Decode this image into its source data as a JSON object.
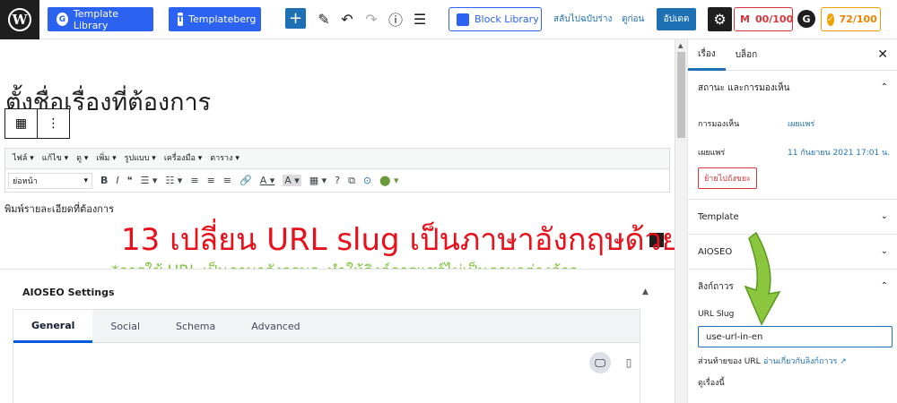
{
  "toolbar": {
    "wp_logo": "W",
    "template_library_label": "Template Library",
    "template_library_icon": "G",
    "templateberg_label": "Templateberg",
    "add_icon": "+",
    "pen_icon": "✎",
    "undo_icon": "↶",
    "redo_icon": "↷",
    "info_icon": "ⓘ",
    "outline_icon": "☰",
    "block_library_label": "Block Library",
    "switch_draft_label": "สลับไปฉบับร่าง",
    "preview_label": "ดูก่อน",
    "publish_label": "อัปเดต",
    "settings_icon": "⚙",
    "seo_score_1": "00/100",
    "seo_score_1_icon": "M",
    "seo_badge": "G",
    "seo_score_2": "72/100",
    "seo_score_2_icon": "✓"
  },
  "editor": {
    "post_title": "ตั้งชื่อเรื่องที่ต้องการ",
    "block_icon": "▦",
    "more_icon": "⋮",
    "menu": [
      "ไฟล์ ▾",
      "แก้ไข ▾",
      "ดู ▾",
      "เพิ่ม ▾",
      "รูปแบบ ▾",
      "เครื่องมือ ▾",
      "ตาราง ▾"
    ],
    "format_select": "ย่อหน้า",
    "format_caret": "▾",
    "tools": [
      "B",
      "I",
      "❝",
      "☰ ▾",
      "☷ ▾",
      "≡",
      "≡",
      "≡",
      "🔗",
      "A ▾",
      "A ▾",
      "▦ ▾",
      "?",
      "⧉",
      "⊙",
      "⬤ ▾"
    ],
    "content_placeholder": "พิมพ์รายละเอียดที่ต้องการ",
    "hint_main": "13 เปลี่ยน URL slug เป็นภาษาอังกฤษด้วย",
    "hint_sub": "*การใช้ URL เป็นภาษาอังกฤษจะทำให้ลิงค์การแชร์ไม่เป็นภาษาต่างด้าว"
  },
  "aioseo": {
    "title": "AIOSEO Settings",
    "collapse_icon": "▲",
    "tabs": [
      "General",
      "Social",
      "Schema",
      "Advanced"
    ],
    "desktop_icon": "🖵",
    "mobile_icon": "▯"
  },
  "sidebar": {
    "tab_post": "เรื่อง",
    "tab_block": "บล็อก",
    "close_icon": "✕",
    "status_heading": "สถานะ และการมองเห็น",
    "visibility_label": "การมองเห็น",
    "visibility_value": "เผยแพร่",
    "publish_label": "เผยแพร่",
    "publish_value": "11 กันยายน 2021 17:01 น.",
    "trash_label": "ย้ายไปถังขยะ",
    "template_heading": "Template",
    "aioseo_heading": "AIOSEO",
    "permalink_heading": "ลิงก์ถาวร",
    "url_slug_label": "URL Slug",
    "url_slug_value": "use-url-in-en",
    "url_end_label": "ส่วนท้ายของ URL",
    "url_end_link": "อ่านเกี่ยวกับลิงก์ถาวร ↗",
    "view_post": "ดูเรื่องนี้",
    "chevron_up": "⌃",
    "chevron_down": "⌄"
  }
}
